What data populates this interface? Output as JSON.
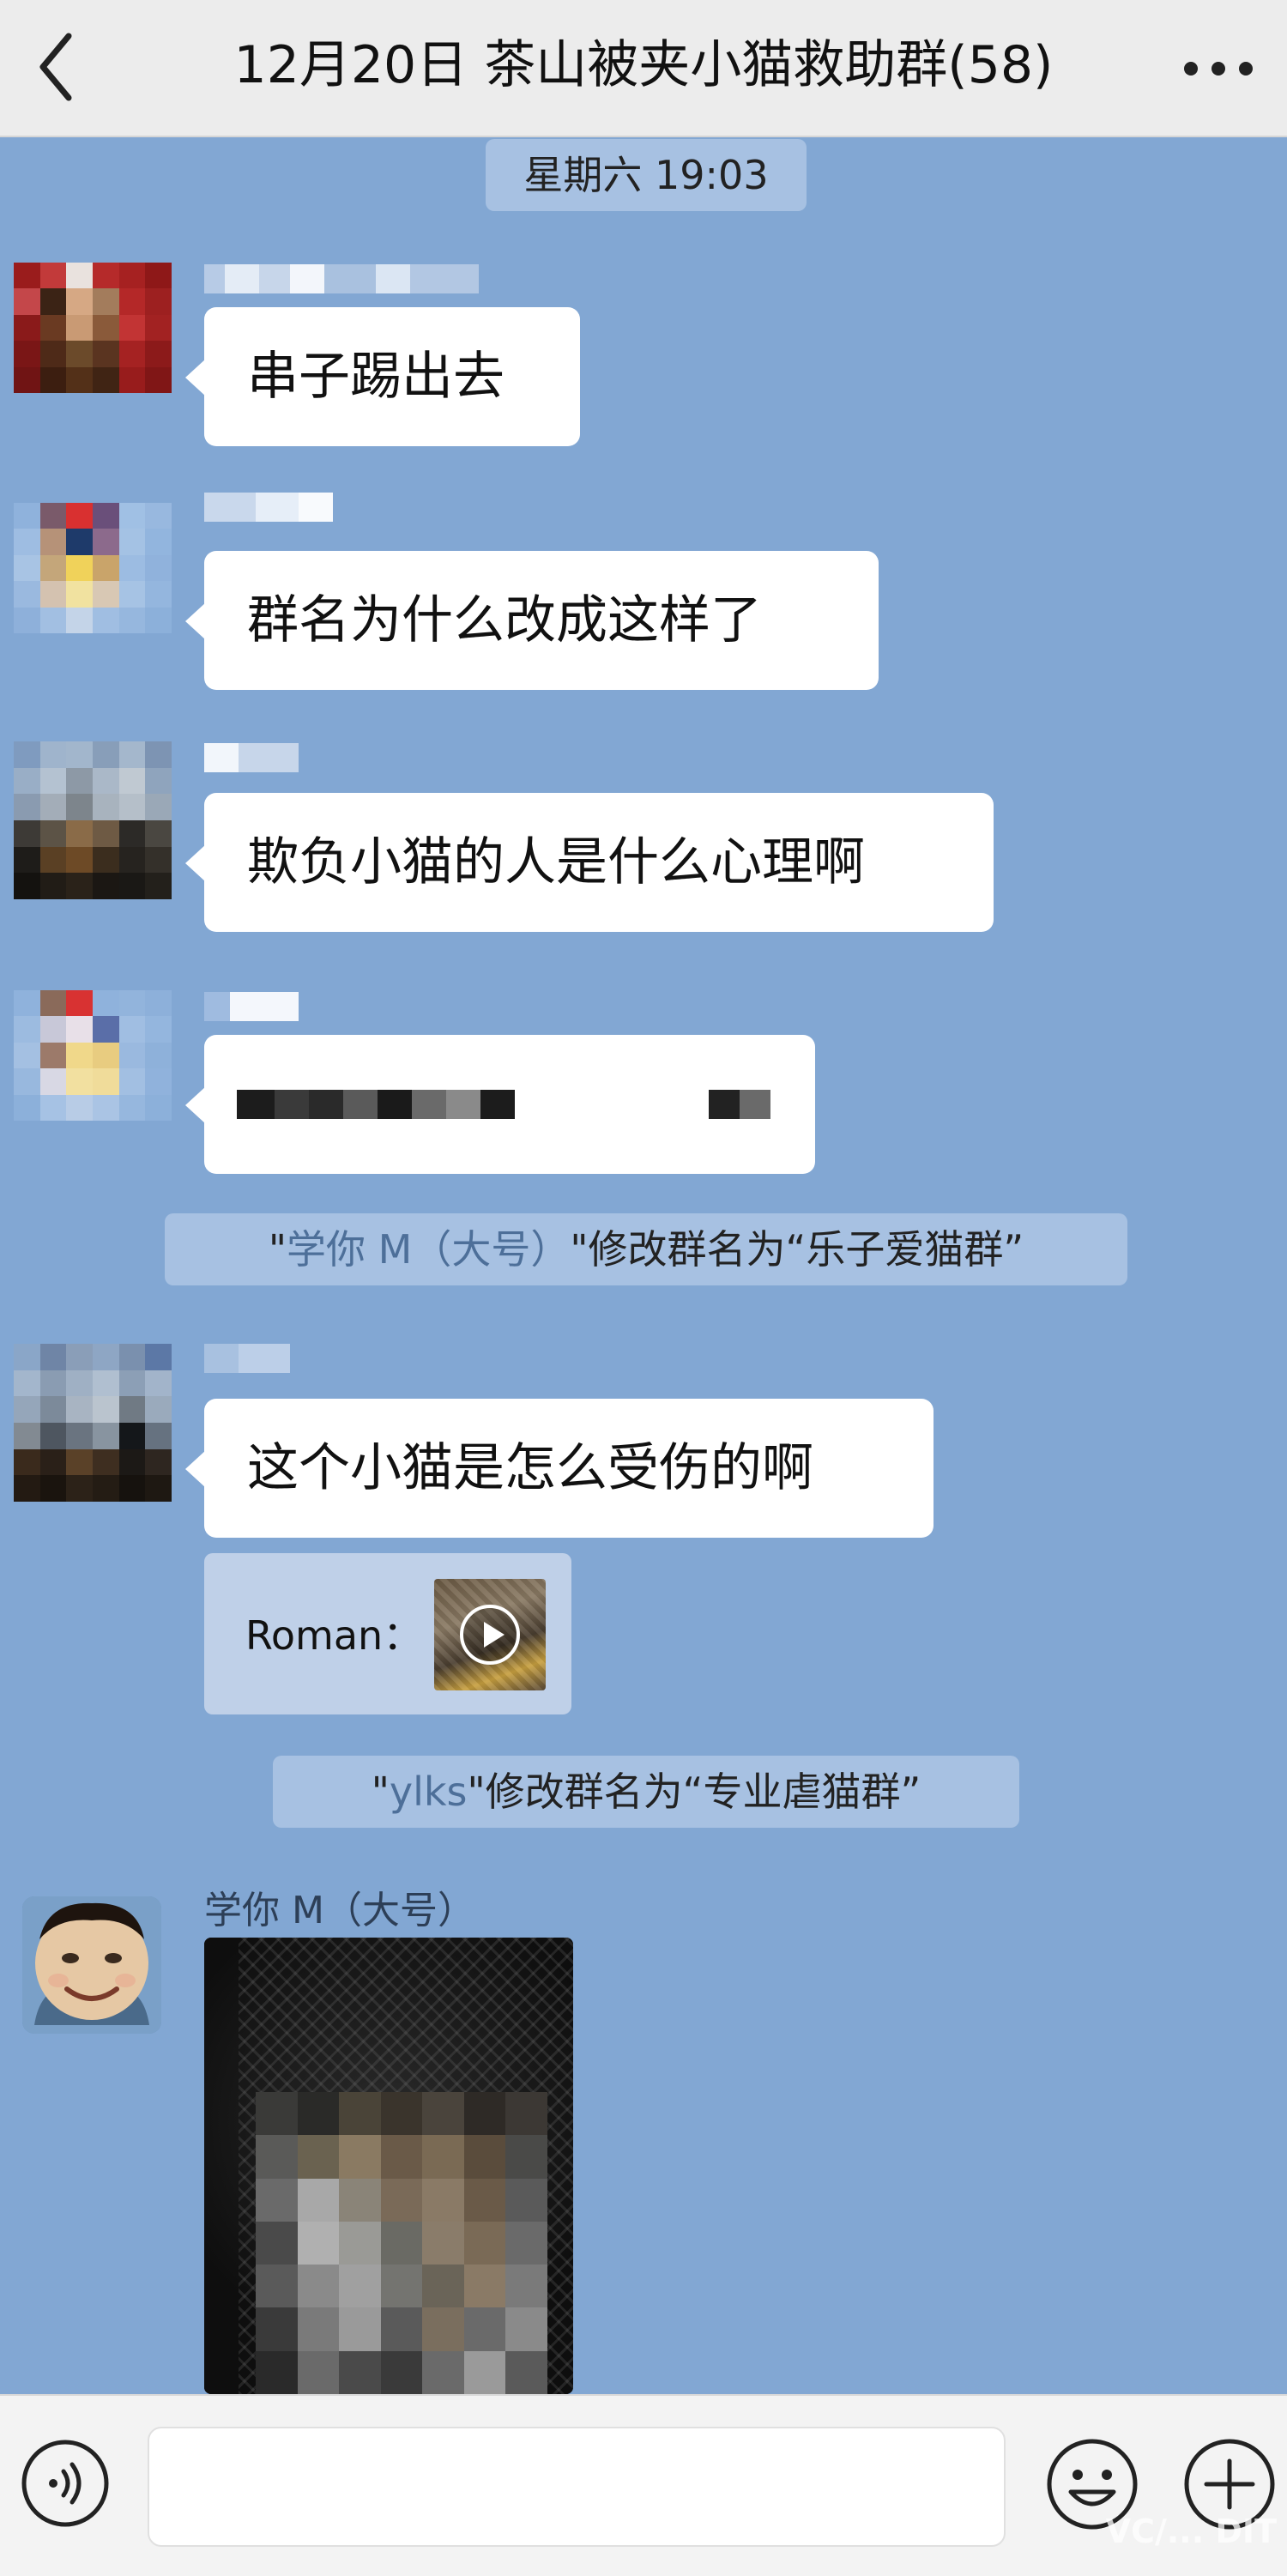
{
  "header": {
    "title": "12月20日 茶山被夹小猫救助群(58)"
  },
  "chat": {
    "time_divider": "星期六 19:03",
    "messages": [
      {
        "text": "串子踢出去"
      },
      {
        "text": "群名为什么改成这样了"
      },
      {
        "text": "欺负小猫的人是什么心理啊"
      },
      {
        "text": ""
      },
      {
        "text": "这个小猫是怎么受伤的啊"
      }
    ],
    "system_notices": [
      {
        "actor": "学你 M（大号）",
        "pre": "\"",
        "post": "\"修改群名为“乐子爱猫群”"
      },
      {
        "actor": "ylks",
        "pre": "\"",
        "post": "\"修改群名为“专业虐猫群”"
      }
    ],
    "quote": {
      "label": "Roman："
    },
    "photo_sender": "学你 M（大号）"
  },
  "footer": {
    "input_value": "",
    "watermark": "VC/...  DIT"
  }
}
